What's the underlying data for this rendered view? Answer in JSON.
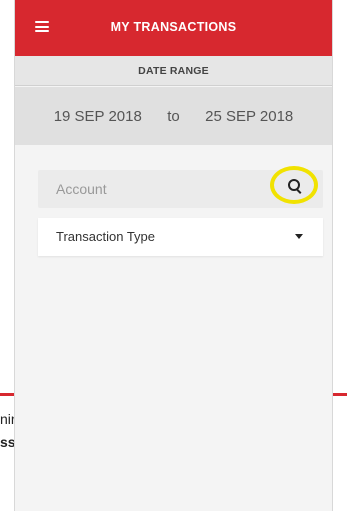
{
  "app_bar": {
    "title": "MY TRANSACTIONS",
    "menu_icon": "hamburger-menu-icon"
  },
  "date_range": {
    "header": "DATE RANGE",
    "from": "19 SEP 2018",
    "separator": "to",
    "to": "25 SEP 2018"
  },
  "filters": {
    "account_placeholder": "Account",
    "account_value": "",
    "search_icon": "search-icon",
    "transaction_type_label": "Transaction Type",
    "dropdown_icon": "chevron-down-icon"
  },
  "background_slide": {
    "fragment_1": "nir",
    "fragment_2": "ss"
  },
  "colors": {
    "brand_red": "#d7282f",
    "highlight_yellow": "#f1e200"
  }
}
